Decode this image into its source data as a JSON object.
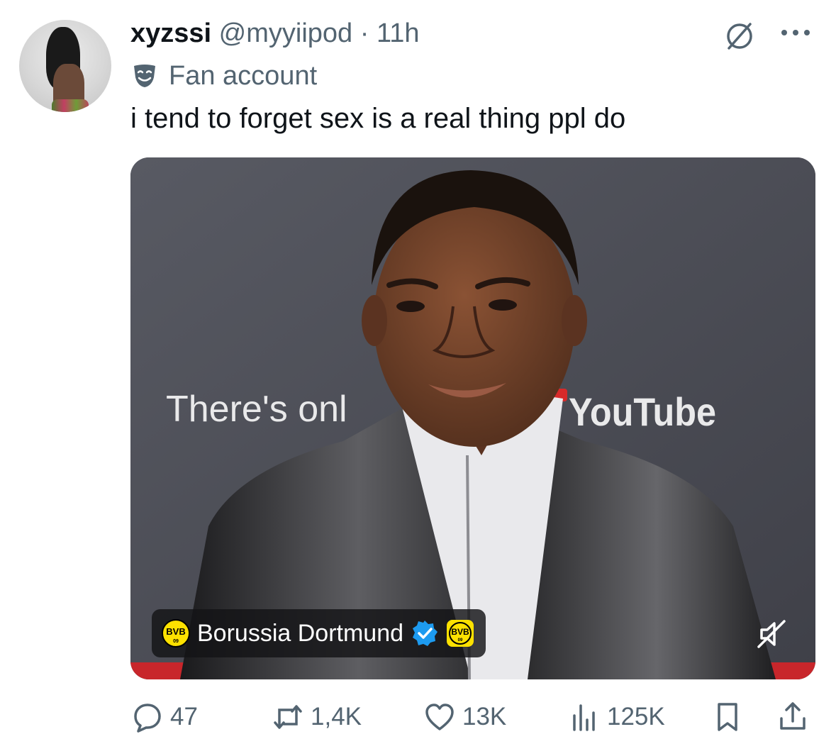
{
  "post": {
    "display_name": "xyzssi",
    "handle": "@myyiipod",
    "separator": "·",
    "timestamp": "11h",
    "badge_label": "Fan account",
    "text": "i tend to forget sex is a real thing ppl do"
  },
  "media": {
    "backdrop_text": "There's onl",
    "backdrop_brand": "YouTube",
    "tagged_account": "Borussia Dortmund",
    "logo_text": "BVB",
    "logo_year": "09"
  },
  "actions": {
    "replies": "47",
    "reposts": "1,4K",
    "likes": "13K",
    "views": "125K"
  },
  "icons": {
    "more": "more-icon",
    "grok": "no-entry-icon",
    "badge": "theater-mask-icon",
    "verified": "verified-badge-icon",
    "mute": "muted-speaker-icon",
    "reply": "reply-icon",
    "repost": "repost-icon",
    "like": "heart-icon",
    "views": "bar-chart-icon",
    "bookmark": "bookmark-icon",
    "share": "share-icon"
  },
  "colors": {
    "text_primary": "#0f1419",
    "text_secondary": "#536471",
    "verified_blue": "#1d9bf0",
    "bvb_yellow": "#fde100"
  }
}
